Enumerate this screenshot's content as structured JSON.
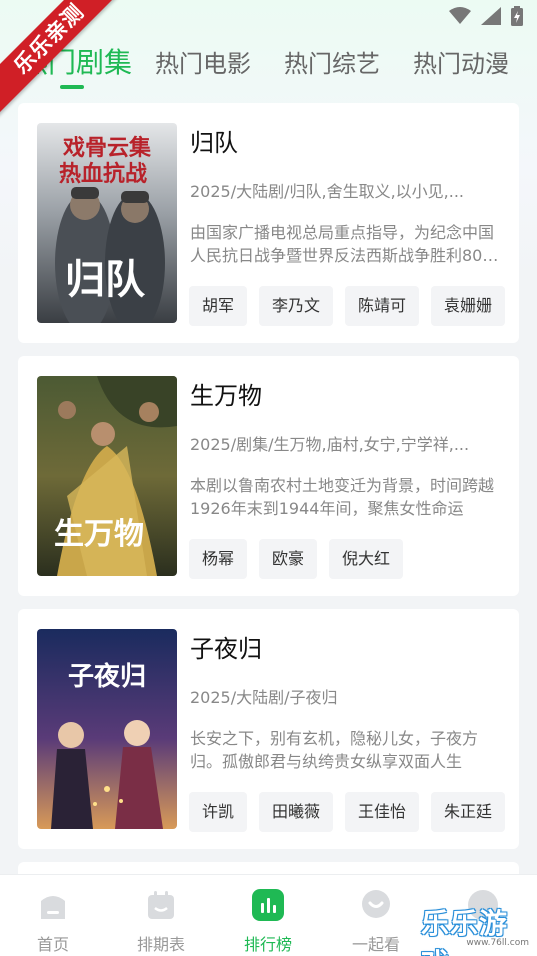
{
  "promo_ribbon": "乐乐亲测",
  "tabs": [
    {
      "label": "热门剧集",
      "active": true
    },
    {
      "label": "热门电影",
      "active": false
    },
    {
      "label": "热门综艺",
      "active": false
    },
    {
      "label": "热门动漫",
      "active": false
    }
  ],
  "shows": [
    {
      "title": "归队",
      "meta": "2025/大陆剧/归队,舍生取义,以小见,...",
      "desc": "由国家广播电视总局重点指导，为纪念中国人民抗日战争暨世界反法西斯战争胜利80周年",
      "cast": [
        "胡军",
        "李乃文",
        "陈靖可",
        "袁姗姗"
      ],
      "poster": {
        "top_text_1": "戏骨云集",
        "top_text_2": "热血抗战",
        "title_art": "归队",
        "colors": [
          "#cdd2d6",
          "#6d747b",
          "#2c2f33"
        ]
      }
    },
    {
      "title": "生万物",
      "meta": "2025/剧集/生万物,庙村,女宁,宁学祥,...",
      "desc": "本剧以鲁南农村土地变迁为背景，时间跨越1926年末到1944年间，聚焦女性命运",
      "cast": [
        "杨幂",
        "欧豪",
        "倪大红"
      ],
      "poster": {
        "title_art": "生万物",
        "colors": [
          "#5b6b3a",
          "#a38a3d",
          "#2e3320"
        ]
      }
    },
    {
      "title": "子夜归",
      "meta": "2025/大陆剧/子夜归",
      "desc": "长安之下，别有玄机，隐秘儿女，子夜方归。孤傲郎君与纨绔贵女纵享双面人生",
      "cast": [
        "许凯",
        "田曦薇",
        "王佳怡",
        "朱正廷"
      ],
      "poster": {
        "title_art": "子夜归",
        "colors": [
          "#1b2a5c",
          "#6a3a7a",
          "#e0a45a"
        ]
      }
    }
  ],
  "bottom_nav": [
    {
      "label": "首页",
      "icon": "home-icon",
      "active": false
    },
    {
      "label": "排期表",
      "icon": "calendar-icon",
      "active": false
    },
    {
      "label": "排行榜",
      "icon": "chart-icon",
      "active": true
    },
    {
      "label": "一起看",
      "icon": "chat-icon",
      "active": false
    },
    {
      "label": "",
      "icon": "avatar-icon",
      "active": false
    }
  ],
  "watermark": {
    "text": "乐乐游戏",
    "url": "www.76ll.com"
  },
  "colors": {
    "accent": "#1fb954",
    "ribbon": "#d01f26"
  }
}
